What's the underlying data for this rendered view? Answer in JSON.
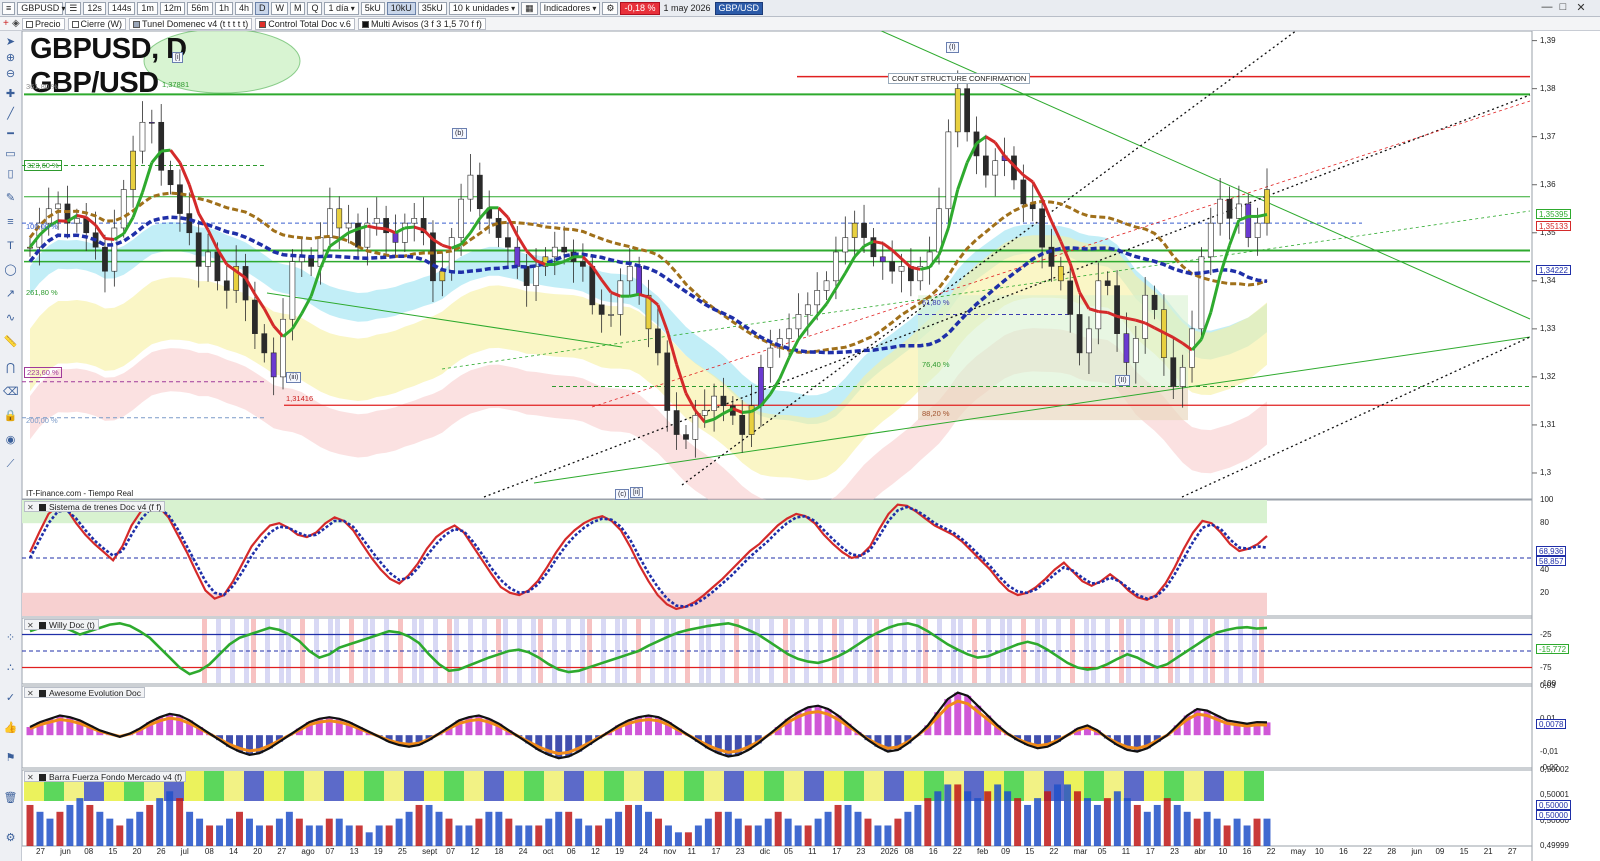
{
  "toolbar": {
    "symbol": "GBPUSD",
    "intervals": [
      "12s",
      "144s",
      "1m",
      "12m",
      "56m",
      "1h",
      "4h",
      "D",
      "W",
      "M",
      "Q"
    ],
    "active_interval": "D",
    "period": "1 día",
    "units": [
      "5kU",
      "10kU",
      "35kU"
    ],
    "active_unit": "10kU",
    "unit_select": "10 k unidades",
    "indicators": "Indicadores",
    "change": "-0,18 %",
    "date": "1 may 2026",
    "pair": "GBP/USD"
  },
  "toolbar2": {
    "items": [
      {
        "label": "Precio",
        "color": "#ffffff"
      },
      {
        "label": "Cierre (W)",
        "color": "#ffffff"
      },
      {
        "label": "Tunel Domenec v4 (t t t t t)",
        "color": "#9aa6b8"
      },
      {
        "label": "Control Total Doc v.6",
        "color": "#e0302a"
      },
      {
        "label": "Multi Avisos (3 f 3 1,5 70 f f)",
        "color": "#111111"
      }
    ]
  },
  "title_line1": "GBPUSD, D",
  "title_line2": "GBP/USD",
  "source": "IT-Finance.com - Tiempo Real",
  "annotations": {
    "count_structure": "COUNT STRUCTURE CONFIRMATION",
    "low_value": "1,31416",
    "high_value": "1,37881"
  },
  "fib_levels": [
    {
      "label": "361,80 %",
      "color": "#8a8a8a"
    },
    {
      "label": "323,60 %",
      "color": "#2e9a2e"
    },
    {
      "label": "100,00 %",
      "color": "#3a5fcf"
    },
    {
      "label": "261,80 %",
      "color": "#2e9a2e"
    },
    {
      "label": "223,60 %",
      "color": "#a03a9a"
    },
    {
      "label": "200,00 %",
      "color": "#7a9ac8"
    },
    {
      "label": "61,80 %",
      "color": "#3a3ab0"
    },
    {
      "label": "76,40 %",
      "color": "#2e9a2e"
    },
    {
      "label": "88,20 %",
      "color": "#a0522d"
    }
  ],
  "waves": [
    "[i]",
    "(b)",
    "[ii]",
    "(c)",
    "(I)",
    "(II)",
    "[ii]",
    "(iii)"
  ],
  "panels": {
    "trains": {
      "label": "Sistema de trenes Doc v4 (f f)",
      "ticks": [
        "100",
        "80",
        "50",
        "40",
        "20"
      ],
      "tags": [
        "68,936",
        "58,857"
      ]
    },
    "willy": {
      "label": "Willy Doc (t)",
      "ticks": [
        "-25",
        "-50",
        "-75",
        "-100"
      ],
      "tags": [
        "-15,772"
      ]
    },
    "awesome": {
      "label": "Awesome Evolution Doc",
      "ticks": [
        "0,03",
        "0,01",
        "-0,01",
        "-0,02"
      ],
      "tags": [
        "0,0078"
      ]
    },
    "barra": {
      "label": "Barra Fuerza Fondo Mercado v4 (f)",
      "ticks": [
        "0,50002",
        "0,50001",
        "0,50000",
        "0,49999"
      ],
      "tags": [
        "0,50000",
        "0,50000"
      ]
    }
  },
  "colors": {
    "up": "#2eaa2e",
    "down": "#d42a2a",
    "blue": "#1f2fa8",
    "cyan_band": "#8fe0f0",
    "yellow_band": "#f6f0a0",
    "pink_band": "#f7c8c8",
    "toolbar_bg": "#e9ecf1"
  },
  "chart_data": [
    {
      "type": "line",
      "title": "GBPUSD, D",
      "subtitle": "GBP/USD",
      "x_labels": [
        "27",
        "jun",
        "08",
        "15",
        "20",
        "26",
        "jul",
        "08",
        "14",
        "20",
        "27",
        "ago",
        "07",
        "13",
        "19",
        "25",
        "sept",
        "07",
        "12",
        "18",
        "24",
        "oct",
        "06",
        "12",
        "19",
        "24",
        "nov",
        "11",
        "17",
        "23",
        "dic",
        "05",
        "11",
        "17",
        "23",
        "2026",
        "08",
        "16",
        "22",
        "feb",
        "09",
        "15",
        "22",
        "mar",
        "05",
        "11",
        "17",
        "23",
        "abr",
        "10",
        "16",
        "22",
        "may",
        "10",
        "16",
        "22",
        "28",
        "jun",
        "09",
        "15",
        "21",
        "27"
      ],
      "y_ticks": [
        "1,39",
        "1,38",
        "1,37",
        "1,36",
        "1,35",
        "1,34",
        "1,33",
        "1,32",
        "1,31",
        "1,3"
      ],
      "ylim": [
        1.295,
        1.392
      ],
      "price_tags": [
        {
          "value": "1,35395",
          "color": "#2eaa2e"
        },
        {
          "value": "1,35133",
          "color": "#d42a2a"
        },
        {
          "value": "1,34222",
          "color": "#1f2fa8"
        }
      ],
      "horizontal_levels": [
        1.3825,
        1.3788,
        1.3575,
        1.3463,
        1.344,
        1.3141
      ],
      "series": [
        {
          "values": [
            1.347,
            1.352,
            1.355,
            1.356,
            1.352,
            1.353,
            1.35,
            1.347,
            1.342,
            1.351,
            1.359,
            1.367,
            1.373,
            1.373,
            1.363,
            1.36,
            1.354,
            1.35,
            1.343,
            1.346,
            1.34,
            1.338,
            1.343,
            1.336,
            1.329,
            1.325,
            1.32,
            1.332,
            1.344,
            1.345,
            1.343,
            1.349,
            1.355,
            1.351,
            1.352,
            1.347,
            1.352,
            1.353,
            1.35,
            1.348,
            1.352,
            1.353,
            1.35,
            1.34,
            1.342,
            1.349,
            1.357,
            1.362,
            1.355,
            1.353,
            1.349,
            1.347,
            1.343,
            1.339,
            1.343,
            1.345,
            1.347,
            1.346,
            1.344,
            1.343,
            1.335,
            1.333,
            1.333,
            1.34,
            1.343,
            1.337,
            1.33,
            1.325,
            1.313,
            1.308,
            1.307,
            1.312,
            1.313,
            1.316,
            1.314,
            1.312,
            1.308,
            1.314,
            1.322,
            1.326,
            1.328,
            1.33,
            1.333,
            1.335,
            1.338,
            1.34,
            1.346,
            1.349,
            1.352,
            1.349,
            1.345,
            1.344,
            1.342,
            1.343,
            1.34,
            1.343,
            1.346,
            1.355,
            1.371,
            1.38,
            1.371,
            1.366,
            1.362,
            1.365,
            1.366,
            1.361,
            1.356,
            1.355,
            1.347,
            1.343,
            1.34,
            1.333,
            1.325,
            1.33,
            1.34,
            1.339,
            1.329,
            1.323,
            1.328,
            1.337,
            1.334,
            1.324,
            1.318,
            1.322,
            1.33,
            1.345,
            1.352,
            1.357,
            1.353,
            1.356,
            1.349,
            1.352,
            1.359
          ]
        }
      ]
    },
    {
      "type": "line",
      "title": "Sistema de trenes Doc v4 (f f)",
      "ylim": [
        0,
        100
      ],
      "y_ticks": [
        100,
        80,
        50,
        40,
        20
      ],
      "series": [
        {
          "values": [
            55,
            72,
            88,
            95,
            92,
            80,
            70,
            62,
            55,
            48,
            60,
            78,
            90,
            96,
            94,
            85,
            70,
            55,
            38,
            22,
            15,
            18,
            30,
            45,
            60,
            70,
            78,
            80,
            76,
            70,
            68,
            72,
            80,
            85,
            82,
            74,
            62,
            50,
            40,
            32,
            28,
            35,
            45,
            58,
            68,
            74,
            78,
            72,
            60,
            48,
            36,
            25,
            20,
            18,
            22,
            30,
            42,
            55,
            66,
            74,
            80,
            84,
            86,
            82,
            74,
            60,
            44,
            30,
            18,
            10,
            6,
            8,
            12,
            18,
            25,
            32,
            40,
            48,
            56,
            62,
            70,
            78,
            84,
            88,
            86,
            80,
            70,
            62,
            55,
            50,
            52,
            60,
            75,
            88,
            96,
            95,
            90,
            84,
            78,
            74,
            70,
            64,
            56,
            48,
            40,
            30,
            22,
            18,
            20,
            25,
            32,
            40,
            46,
            38,
            30,
            26,
            30,
            36,
            30,
            22,
            16,
            14,
            18,
            28,
            42,
            58,
            72,
            82,
            80,
            72,
            62,
            56,
            58,
            62,
            69
          ]
        },
        {
          "values": [
            50,
            65,
            80,
            90,
            91,
            84,
            74,
            65,
            58,
            52,
            56,
            70,
            83,
            92,
            93,
            87,
            75,
            60,
            45,
            30,
            20,
            18,
            26,
            38,
            52,
            63,
            72,
            77,
            76,
            72,
            69,
            70,
            76,
            82,
            82,
            77,
            67,
            56,
            46,
            37,
            31,
            33,
            41,
            52,
            62,
            70,
            75,
            73,
            64,
            53,
            41,
            31,
            24,
            20,
            21,
            27,
            37,
            49,
            60,
            69,
            76,
            81,
            84,
            83,
            77,
            66,
            51,
            37,
            25,
            15,
            9,
            8,
            10,
            15,
            21,
            28,
            35,
            43,
            51,
            58,
            65,
            73,
            80,
            85,
            86,
            82,
            74,
            66,
            59,
            53,
            52,
            57,
            69,
            82,
            91,
            94,
            91,
            86,
            80,
            76,
            72,
            66,
            59,
            51,
            43,
            34,
            26,
            21,
            20,
            23,
            29,
            36,
            42,
            39,
            33,
            28,
            29,
            33,
            30,
            24,
            18,
            15,
            17,
            24,
            36,
            50,
            64,
            76,
            79,
            75,
            66,
            59,
            58,
            60,
            59
          ]
        }
      ]
    },
    {
      "type": "line",
      "title": "Willy Doc (t)",
      "ylim": [
        -100,
        0
      ],
      "y_ticks": [
        -25,
        -50,
        -75,
        -100
      ],
      "series": [
        {
          "values": [
            -20,
            -15,
            -10,
            -12,
            -18,
            -25,
            -20,
            -15,
            -10,
            -8,
            -12,
            -20,
            -30,
            -45,
            -60,
            -75,
            -85,
            -80,
            -70,
            -55,
            -40,
            -30,
            -25,
            -20,
            -15,
            -18,
            -25,
            -35,
            -50,
            -60,
            -55,
            -45,
            -40,
            -35,
            -30,
            -25,
            -20,
            -22,
            -28,
            -38,
            -55,
            -70,
            -80,
            -78,
            -72,
            -66,
            -60,
            -55,
            -50,
            -48,
            -52,
            -60,
            -70,
            -78,
            -82,
            -80,
            -75,
            -70,
            -65,
            -60,
            -55,
            -50,
            -42,
            -35,
            -28,
            -22,
            -18,
            -15,
            -12,
            -10,
            -8,
            -12,
            -18,
            -25,
            -35,
            -45,
            -55,
            -62,
            -66,
            -68,
            -64,
            -58,
            -50,
            -40,
            -30,
            -22,
            -15,
            -10,
            -8,
            -12,
            -20,
            -30,
            -40,
            -48,
            -55,
            -60,
            -58,
            -52,
            -46,
            -40,
            -36,
            -40,
            -48,
            -58,
            -68,
            -75,
            -78,
            -76,
            -70,
            -62,
            -55,
            -60,
            -68,
            -75,
            -70,
            -60,
            -50,
            -40,
            -30,
            -22,
            -18,
            -15,
            -14,
            -16,
            -15
          ]
        }
      ]
    },
    {
      "type": "bar",
      "title": "Awesome Evolution Doc",
      "ylim": [
        -0.02,
        0.03
      ],
      "y_ticks": [
        0.03,
        0.01,
        -0.01,
        -0.02
      ],
      "series": [
        {
          "values": [
            0.005,
            0.008,
            0.01,
            0.012,
            0.011,
            0.009,
            0.006,
            0.003,
            0.001,
            -0.001,
            0.001,
            0.004,
            0.008,
            0.011,
            0.013,
            0.012,
            0.009,
            0.005,
            0.001,
            -0.003,
            -0.007,
            -0.01,
            -0.012,
            -0.011,
            -0.008,
            -0.004,
            0.0,
            0.004,
            0.008,
            0.01,
            0.011,
            0.01,
            0.008,
            0.005,
            0.002,
            -0.001,
            -0.004,
            -0.006,
            -0.007,
            -0.006,
            -0.003,
            0.001,
            0.005,
            0.009,
            0.011,
            0.012,
            0.01,
            0.007,
            0.003,
            -0.001,
            -0.005,
            -0.009,
            -0.012,
            -0.014,
            -0.013,
            -0.01,
            -0.006,
            -0.002,
            0.002,
            0.006,
            0.009,
            0.011,
            0.012,
            0.011,
            0.008,
            0.004,
            0.0,
            -0.004,
            -0.008,
            -0.011,
            -0.013,
            -0.012,
            -0.009,
            -0.005,
            0.0,
            0.005,
            0.01,
            0.014,
            0.017,
            0.018,
            0.016,
            0.012,
            0.007,
            0.002,
            -0.003,
            -0.007,
            -0.01,
            -0.009,
            -0.005,
            0.0,
            0.006,
            0.014,
            0.022,
            0.026,
            0.024,
            0.018,
            0.012,
            0.006,
            0.001,
            -0.003,
            -0.006,
            -0.008,
            -0.007,
            -0.004,
            0.0,
            0.004,
            0.006,
            0.003,
            -0.002,
            -0.006,
            -0.009,
            -0.01,
            -0.008,
            -0.004,
            0.0,
            0.006,
            0.012,
            0.016,
            0.015,
            0.012,
            0.009,
            0.008,
            0.007,
            0.008,
            0.0078
          ]
        }
      ]
    },
    {
      "type": "bar",
      "title": "Barra Fuerza Fondo Mercado v4 (f)",
      "ylim": [
        0.49999,
        0.50002
      ],
      "y_ticks": [
        0.50002,
        0.50001,
        0.5,
        0.49999
      ],
      "series": [
        {
          "values": [
            0.6,
            0.5,
            0.4,
            0.5,
            0.6,
            0.7,
            0.6,
            0.5,
            0.4,
            0.3,
            0.4,
            0.5,
            0.6,
            0.7,
            0.8,
            0.7,
            0.5,
            0.4,
            0.3,
            0.3,
            0.4,
            0.5,
            0.4,
            0.3,
            0.3,
            0.4,
            0.5,
            0.4,
            0.3,
            0.3,
            0.4,
            0.4,
            0.3,
            0.3,
            0.2,
            0.3,
            0.3,
            0.4,
            0.5,
            0.6,
            0.6,
            0.5,
            0.4,
            0.3,
            0.3,
            0.4,
            0.5,
            0.5,
            0.4,
            0.3,
            0.3,
            0.3,
            0.4,
            0.5,
            0.5,
            0.4,
            0.3,
            0.3,
            0.4,
            0.5,
            0.6,
            0.6,
            0.5,
            0.4,
            0.3,
            0.2,
            0.2,
            0.3,
            0.4,
            0.5,
            0.5,
            0.4,
            0.3,
            0.3,
            0.4,
            0.5,
            0.4,
            0.3,
            0.3,
            0.4,
            0.5,
            0.6,
            0.6,
            0.5,
            0.4,
            0.3,
            0.3,
            0.4,
            0.5,
            0.6,
            0.7,
            0.8,
            0.9,
            0.9,
            0.8,
            0.7,
            0.8,
            0.9,
            0.8,
            0.7,
            0.6,
            0.7,
            0.8,
            0.9,
            0.9,
            0.8,
            0.7,
            0.6,
            0.7,
            0.8,
            0.7,
            0.6,
            0.5,
            0.6,
            0.7,
            0.6,
            0.5,
            0.4,
            0.5,
            0.4,
            0.3,
            0.4,
            0.3,
            0.4,
            0.4
          ]
        }
      ]
    }
  ]
}
